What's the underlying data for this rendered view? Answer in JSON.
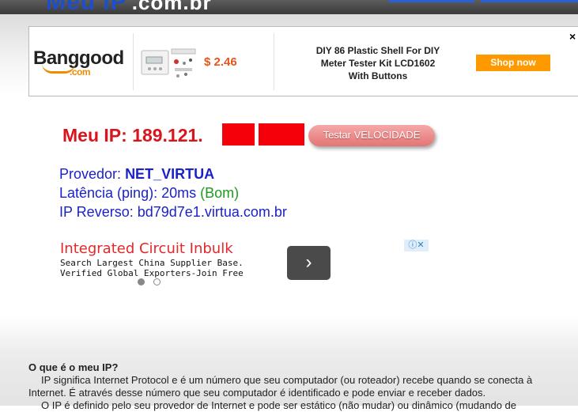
{
  "header": {
    "logo_main": "Meu IP",
    "logo_suffix": ".com.br"
  },
  "ad_banner": {
    "brand": "Banggood",
    "brand_domain": ".com",
    "price": "$ 2.46",
    "product_title": "DIY 86 Plastic Shell For DIY Meter Tester Kit LCD1602 With Buttons",
    "shop_label": "Shop now",
    "close_label": "×"
  },
  "ip": {
    "label": "Meu IP:",
    "value_visible": "189.121.",
    "test_speed_label": "Testar VELOCIDADE"
  },
  "info": {
    "provider_label": "Provedor:",
    "provider_value": "NET_VIRTUA",
    "latency_label": "Latência (ping):",
    "latency_value": "20ms",
    "latency_status": "(Bom)",
    "reverse_label": "IP Reverso:",
    "reverse_value": "bd79d7e1.virtua.com.br"
  },
  "google_ad": {
    "title": "Integrated Circuit Inbulk",
    "line1": "Search Largest China Supplier Base.",
    "line2": "Verified Global Exporters-Join Free",
    "next_label": "›",
    "adchoices_label": "ⓘ✕"
  },
  "faq": {
    "question": "O que é o meu IP?",
    "line1": "IP significa Internet Protocol e é um número que seu computador (ou roteador) recebe quando se conecta à",
    "line2": "Internet. É através desse número que seu computador é identificado e pode enviar e receber dados.",
    "line3": "O IP é definido pelo seu provedor de Internet e pode ser estático (não mudar) ou dinâmico (mudando de"
  },
  "colors": {
    "ip_red": "#d9141c",
    "info_blue": "#1a22c9",
    "good_green": "#1e9b1e",
    "shop_orange": "#ff9900"
  }
}
